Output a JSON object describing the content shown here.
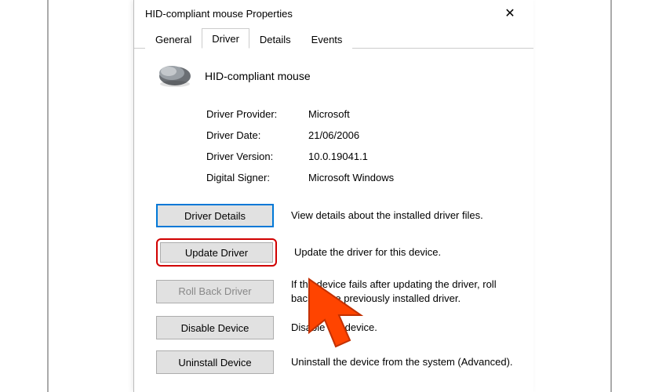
{
  "window": {
    "title": "HID-compliant mouse Properties"
  },
  "tabs": {
    "general": "General",
    "driver": "Driver",
    "details": "Details",
    "events": "Events"
  },
  "device": {
    "name": "HID-compliant mouse"
  },
  "info": {
    "provider_label": "Driver Provider:",
    "provider_value": "Microsoft",
    "date_label": "Driver Date:",
    "date_value": "21/06/2006",
    "version_label": "Driver Version:",
    "version_value": "10.0.19041.1",
    "signer_label": "Digital Signer:",
    "signer_value": "Microsoft Windows"
  },
  "buttons": {
    "details": "Driver Details",
    "details_desc": "View details about the installed driver files.",
    "update": "Update Driver",
    "update_desc": "Update the driver for this device.",
    "rollback": "Roll Back Driver",
    "rollback_desc": "If the device fails after updating the driver, roll back to the previously installed driver.",
    "disable": "Disable Device",
    "disable_desc": "Disable the device.",
    "uninstall": "Uninstall Device",
    "uninstall_desc": "Uninstall the device from the system (Advanced)."
  }
}
